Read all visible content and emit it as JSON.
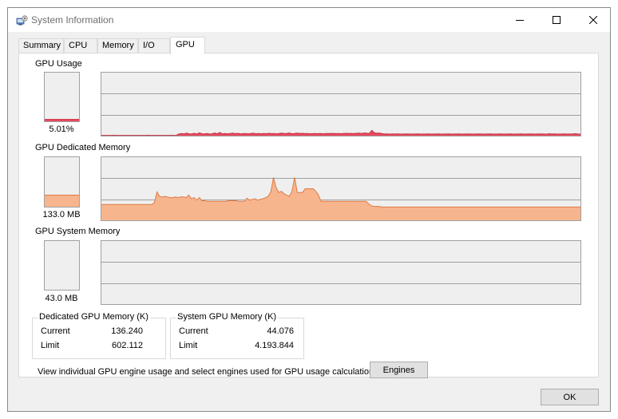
{
  "window": {
    "title": "System Information"
  },
  "tabs": [
    {
      "label": "Summary",
      "active": false
    },
    {
      "label": "CPU",
      "active": false
    },
    {
      "label": "Memory",
      "active": false
    },
    {
      "label": "I/O",
      "active": false
    },
    {
      "label": "GPU",
      "active": true
    }
  ],
  "gpu_usage": {
    "label": "GPU Usage",
    "value_text": "5.01%",
    "level": 0.05,
    "color": "#e84a5f",
    "history": [
      0.5,
      0.5,
      0.5,
      0.5,
      0.5,
      0.6,
      0.5,
      0.5,
      0.5,
      0.5,
      0.5,
      0.5,
      0.5,
      0.5,
      0.5,
      0.5,
      0.5,
      0.5,
      0.6,
      0.5,
      0.5,
      0.5,
      0.5,
      0.5,
      0.5,
      0.5,
      0.5,
      0.6,
      0.5,
      0.5,
      2.5,
      3.5,
      2.8,
      4.0,
      3.0,
      2.6,
      3.8,
      2.5,
      4.5,
      3.2,
      2.8,
      3.5,
      2.6,
      3.0,
      4.2,
      3.0,
      5.0,
      2.8,
      3.6,
      3.0,
      3.4,
      4.0,
      3.2,
      3.8,
      2.9,
      3.3,
      3.6,
      3.1,
      3.5,
      3.9,
      3.2,
      3.4,
      3.0,
      3.6,
      3.2,
      3.8,
      3.3,
      3.5,
      3.1,
      3.6,
      4.2,
      3.3,
      3.7,
      4.3,
      3.1,
      3.6,
      4.0,
      3.4,
      3.8,
      3.3,
      3.6,
      3.0,
      3.3,
      3.6,
      3.2,
      3.5,
      3.0,
      3.3,
      3.6,
      3.4,
      3.7,
      3.3,
      3.6,
      3.2,
      3.5,
      3.8,
      3.4,
      3.7,
      3.3,
      3.8,
      4.0,
      3.6,
      4.3,
      3.9,
      3.5,
      8.5,
      4.6,
      3.9,
      4.2,
      3.3,
      2.6,
      2.9,
      2.5,
      2.8,
      2.6,
      2.9,
      2.5,
      2.7,
      2.6,
      2.8,
      2.5,
      2.7,
      2.6,
      2.8,
      2.5,
      2.7,
      2.6,
      2.8,
      2.5,
      2.7,
      2.6,
      2.8,
      2.5,
      2.7,
      2.6,
      2.8,
      2.5,
      2.7,
      2.6,
      2.8,
      2.5,
      2.7,
      2.6,
      2.8,
      2.5,
      2.7,
      2.6,
      2.8,
      2.5,
      2.7,
      2.6,
      2.8,
      2.5,
      2.7,
      2.6,
      2.8,
      2.5,
      2.7,
      2.6,
      2.8,
      2.5,
      2.7,
      2.6,
      2.8,
      2.5,
      2.7,
      2.6,
      2.8,
      2.5,
      2.7,
      2.6,
      2.8,
      2.5,
      2.7,
      3.0,
      2.6,
      2.8,
      2.5,
      2.7,
      2.6,
      2.9,
      2.5,
      2.7,
      2.6,
      3.2,
      2.6,
      2.4
    ]
  },
  "gpu_dedicated": {
    "label": "GPU Dedicated Memory",
    "value_text": "133.0 MB",
    "level": 0.24,
    "color": "#f7b58d",
    "history": [
      25,
      25,
      25,
      25,
      25,
      25,
      25,
      25,
      25,
      25,
      25,
      25,
      25,
      25,
      25,
      25,
      25,
      25,
      25,
      25,
      28,
      45,
      38,
      37,
      38,
      37,
      36,
      36,
      37,
      36,
      37,
      37,
      36,
      40,
      34,
      36,
      32,
      36,
      31,
      31,
      30,
      30,
      30,
      30,
      30,
      30,
      30,
      30,
      31,
      31,
      31,
      31,
      30,
      30,
      30,
      35,
      32,
      33,
      34,
      32,
      33,
      34,
      36,
      38,
      45,
      68,
      52,
      44,
      46,
      42,
      40,
      38,
      46,
      68,
      44,
      44,
      44,
      50,
      50,
      50,
      50,
      46,
      40,
      30,
      30,
      30,
      30,
      30,
      30,
      30,
      30,
      30,
      30,
      30,
      30,
      30,
      30,
      30,
      30,
      30,
      30,
      26,
      23,
      22,
      22,
      22,
      21,
      21,
      21,
      21,
      21,
      21,
      21,
      21,
      21,
      21,
      21,
      21,
      21,
      21,
      21,
      21,
      21,
      21,
      21,
      21,
      21,
      21,
      21,
      21,
      21,
      21,
      21,
      21,
      21,
      21,
      21,
      21,
      21,
      21,
      21,
      21,
      21,
      21,
      21,
      21,
      21,
      21,
      21,
      21,
      21,
      21,
      21,
      21,
      21,
      21,
      21,
      21,
      21,
      21,
      21,
      21,
      21,
      21,
      21,
      21,
      21,
      21,
      21,
      21,
      21,
      21,
      21,
      21,
      21,
      21,
      21,
      21,
      21,
      21,
      21,
      21
    ]
  },
  "gpu_system": {
    "label": "GPU System Memory",
    "value_text": "43.0 MB",
    "level": 0.0,
    "color": "#8fb3e3",
    "history": []
  },
  "dedicated_group": {
    "title": "Dedicated GPU Memory (K)",
    "current_label": "Current",
    "current_value": "136.240",
    "limit_label": "Limit",
    "limit_value": "602.112"
  },
  "system_group": {
    "title": "System GPU Memory (K)",
    "current_label": "Current",
    "current_value": "44.076",
    "limit_label": "Limit",
    "limit_value": "4.193.844"
  },
  "engines_text": "View individual GPU engine usage and select engines used for GPU usage calculations:",
  "engines_button": "Engines",
  "ok_button": "OK"
}
